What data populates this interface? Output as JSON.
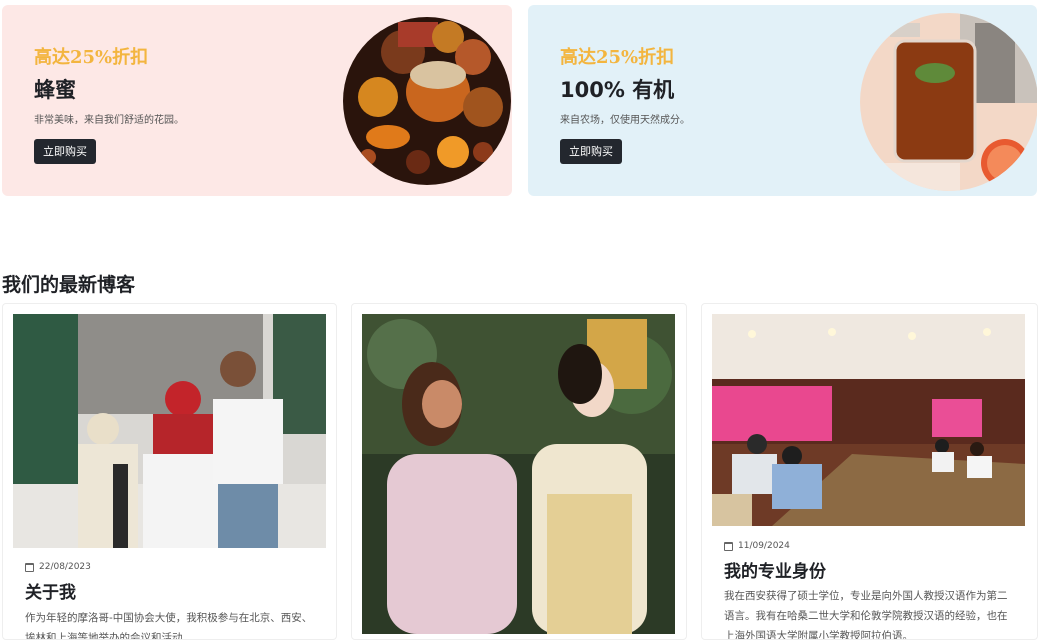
{
  "promos": [
    {
      "discount": "高达25%折扣",
      "title": "蜂蜜",
      "subtitle": "非常美味，来自我们舒适的花园。",
      "button": "立即购买",
      "image": "honey-spices-image"
    },
    {
      "discount": "高达25%折扣",
      "title": "100% 有机",
      "subtitle": "来自农场，仅使用天然成分。",
      "button": "立即购买",
      "image": "honey-jar-tea-image"
    }
  ],
  "blog": {
    "heading": "我们的最新博客",
    "posts": [
      {
        "date": "22/08/2023",
        "title": "关于我",
        "excerpt": "作为年轻的摩洛哥-中国协会大使，我积极参与在北京、西安、埃林和上海等地举办的会议和活动。",
        "image": "classroom-photo"
      },
      {
        "date": "",
        "title": "",
        "excerpt": "",
        "image": "traditional-dress-photo"
      },
      {
        "date": "11/09/2024",
        "title": "我的专业身份",
        "excerpt": "我在西安获得了硕士学位，专业是向外国人教授汉语作为第二语言。我有在哈桑二世大学和伦敦学院教授汉语的经验，也在上海外国语大学附属小学教授阿拉伯语。",
        "image": "conference-room-photo"
      }
    ]
  },
  "colors": {
    "accent": "#f3b53f",
    "promo_pink": "#fde8e6",
    "promo_blue": "#e2f1f8",
    "button": "#23272e"
  }
}
